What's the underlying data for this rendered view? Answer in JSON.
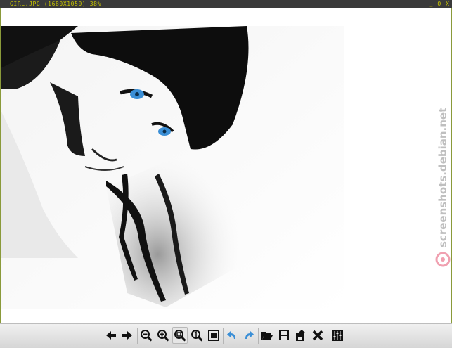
{
  "window": {
    "title": "GIRL.JPG (1680X1050) 38%",
    "minimize_label": "_",
    "maximize_label": "O",
    "close_label": "X"
  },
  "watermark": {
    "text": "screenshots.debian.net"
  },
  "colors": {
    "titlebar_bg": "#3a3a3a",
    "title_text": "#c8c400",
    "accent_blue": "#3b8fd6"
  },
  "toolbar": {
    "buttons": [
      {
        "name": "previous-image",
        "icon": "arrow-left-icon"
      },
      {
        "name": "next-image",
        "icon": "arrow-right-icon"
      },
      {
        "name": "zoom-out",
        "icon": "zoom-out-icon"
      },
      {
        "name": "zoom-in",
        "icon": "zoom-in-icon"
      },
      {
        "name": "zoom-fit",
        "icon": "zoom-fit-icon",
        "active": true
      },
      {
        "name": "zoom-original",
        "icon": "zoom-100-icon"
      },
      {
        "name": "fullscreen",
        "icon": "fullscreen-icon"
      },
      {
        "name": "rotate-left",
        "icon": "rotate-left-icon"
      },
      {
        "name": "rotate-right",
        "icon": "rotate-right-icon"
      },
      {
        "name": "open-file",
        "icon": "folder-open-icon"
      },
      {
        "name": "save-file",
        "icon": "save-icon"
      },
      {
        "name": "save-as",
        "icon": "save-as-icon"
      },
      {
        "name": "delete-file",
        "icon": "delete-icon"
      },
      {
        "name": "preferences",
        "icon": "settings-sliders-icon"
      }
    ]
  }
}
